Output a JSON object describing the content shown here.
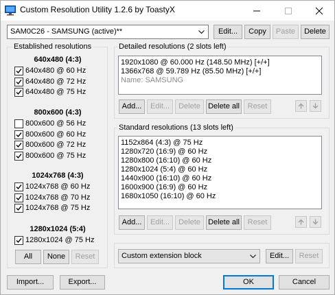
{
  "window": {
    "title": "Custom Resolution Utility 1.2.6 by ToastyX",
    "title_icon": "monitor-icon",
    "controls": [
      "minimize-icon",
      "maximize-icon",
      "close-icon"
    ]
  },
  "toolbar": {
    "monitor_select": "SAM0C26 - SAMSUNG (active)**",
    "edit_label": "Edit...",
    "copy_label": "Copy",
    "paste_label": "Paste",
    "delete_label": "Delete"
  },
  "established": {
    "group_label": "Established resolutions",
    "sections": [
      {
        "heading": "640x480 (4:3)",
        "items": [
          {
            "label": "640x480 @ 60 Hz",
            "checked": true
          },
          {
            "label": "640x480 @ 72 Hz",
            "checked": true
          },
          {
            "label": "640x480 @ 75 Hz",
            "checked": true
          }
        ]
      },
      {
        "heading": "800x600 (4:3)",
        "items": [
          {
            "label": "800x600 @ 56 Hz",
            "checked": false
          },
          {
            "label": "800x600 @ 60 Hz",
            "checked": true
          },
          {
            "label": "800x600 @ 72 Hz",
            "checked": true
          },
          {
            "label": "800x600 @ 75 Hz",
            "checked": true
          }
        ]
      },
      {
        "heading": "1024x768 (4:3)",
        "items": [
          {
            "label": "1024x768 @ 60 Hz",
            "checked": true
          },
          {
            "label": "1024x768 @ 70 Hz",
            "checked": true
          },
          {
            "label": "1024x768 @ 75 Hz",
            "checked": true
          }
        ]
      },
      {
        "heading": "1280x1024 (5:4)",
        "items": [
          {
            "label": "1280x1024 @ 75 Hz",
            "checked": true
          }
        ]
      }
    ],
    "all_label": "All",
    "none_label": "None",
    "reset_label": "Reset"
  },
  "detailed": {
    "group_label": "Detailed resolutions (2 slots left)",
    "items": [
      "1920x1080 @ 60.000 Hz (148.50 MHz) [+/+]",
      "1366x768 @ 59.789 Hz (85.50 MHz) [+/+]"
    ],
    "name_item": "Name: SAMSUNG",
    "add_label": "Add...",
    "edit_label": "Edit...",
    "delete_label": "Delete",
    "delete_all_label": "Delete all",
    "reset_label": "Reset",
    "move_up_icon": "arrow-up-icon",
    "move_down_icon": "arrow-down-icon"
  },
  "standard": {
    "group_label": "Standard resolutions (13 slots left)",
    "items": [
      "1152x864 (4:3) @ 75 Hz",
      "1280x720 (16:9) @ 60 Hz",
      "1280x800 (16:10) @ 60 Hz",
      "1280x1024 (5:4) @ 60 Hz",
      "1440x900 (16:10) @ 60 Hz",
      "1600x900 (16:9) @ 60 Hz",
      "1680x1050 (16:10) @ 60 Hz"
    ],
    "add_label": "Add...",
    "edit_label": "Edit...",
    "delete_label": "Delete",
    "delete_all_label": "Delete all",
    "reset_label": "Reset"
  },
  "extension": {
    "select": "Custom extension block",
    "edit_label": "Edit...",
    "reset_label": "Reset"
  },
  "footer": {
    "import_label": "Import...",
    "export_label": "Export...",
    "ok_label": "OK",
    "cancel_label": "Cancel"
  }
}
